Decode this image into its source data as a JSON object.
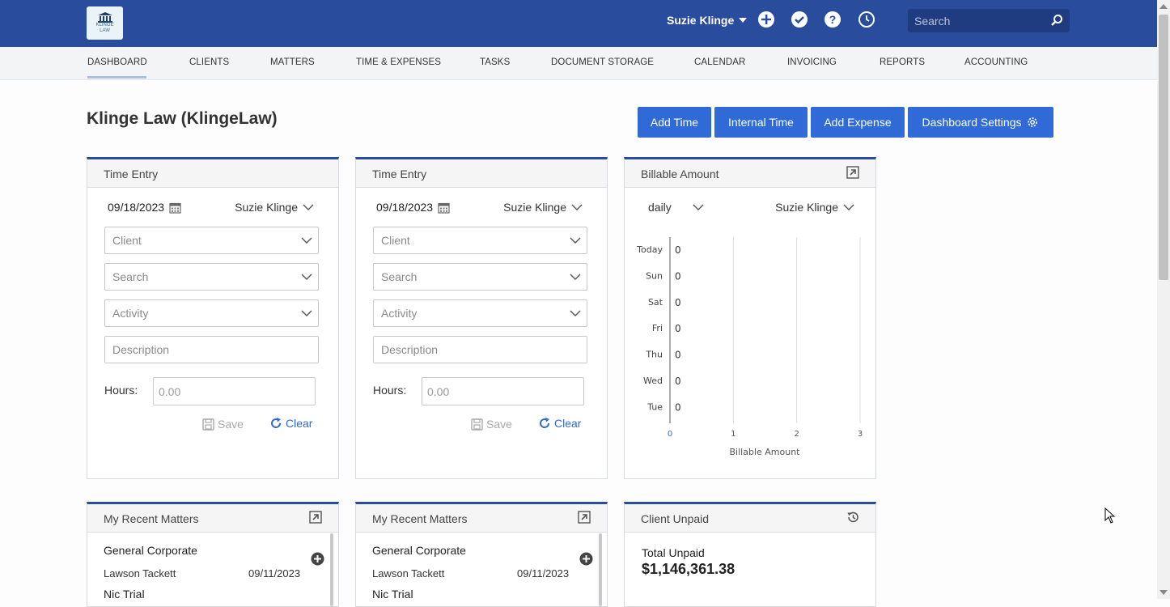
{
  "app": {
    "logo_text_1": "KLINGE",
    "logo_text_2": "LAW",
    "user_name": "Suzie Klinge",
    "search_placeholder": "Search"
  },
  "nav": {
    "items": [
      "DASHBOARD",
      "CLIENTS",
      "MATTERS",
      "TIME & EXPENSES",
      "TASKS",
      "DOCUMENT STORAGE",
      "CALENDAR",
      "INVOICING",
      "REPORTS",
      "ACCOUNTING"
    ],
    "active": "DASHBOARD"
  },
  "page": {
    "title": "Klinge Law (KlingeLaw)",
    "buttons": {
      "add_time": "Add Time",
      "internal_time": "Internal Time",
      "add_expense": "Add Expense",
      "dashboard_settings": "Dashboard Settings"
    }
  },
  "time_entry": [
    {
      "title": "Time Entry",
      "date": "09/18/2023",
      "user": "Suzie Klinge",
      "client_placeholder": "Client",
      "search_placeholder": "Search",
      "activity_placeholder": "Activity",
      "description_placeholder": "Description",
      "hours_label": "Hours:",
      "hours_placeholder": "0.00",
      "save_label": "Save",
      "clear_label": "Clear"
    },
    {
      "title": "Time Entry",
      "date": "09/18/2023",
      "user": "Suzie Klinge",
      "client_placeholder": "Client",
      "search_placeholder": "Search",
      "activity_placeholder": "Activity",
      "description_placeholder": "Description",
      "hours_label": "Hours:",
      "hours_placeholder": "0.00",
      "save_label": "Save",
      "clear_label": "Clear"
    }
  ],
  "billable": {
    "title": "Billable Amount",
    "period": "daily",
    "user": "Suzie Klinge",
    "chart_data": {
      "type": "bar",
      "orientation": "horizontal",
      "categories": [
        "Today",
        "Sun",
        "Sat",
        "Fri",
        "Thu",
        "Wed",
        "Tue"
      ],
      "values": [
        0,
        0,
        0,
        0,
        0,
        0,
        0
      ],
      "xlabel": "Billable Amount",
      "xticks": [
        "0",
        "1",
        "2",
        "3"
      ],
      "xlim": [
        0,
        3
      ],
      "grid": true
    }
  },
  "recent_matters": [
    {
      "title": "My Recent Matters",
      "matter": "General Corporate",
      "client": "Lawson Tackett",
      "date": "09/11/2023",
      "next_matter": "Nic Trial"
    },
    {
      "title": "My Recent Matters",
      "matter": "General Corporate",
      "client": "Lawson Tackett",
      "date": "09/11/2023",
      "next_matter": "Nic Trial"
    }
  ],
  "client_unpaid": {
    "title": "Client Unpaid",
    "label": "Total Unpaid",
    "amount": "$1,146,361.38"
  },
  "colors": {
    "brand": "#2a4c9c",
    "button": "#2f6ad6"
  }
}
